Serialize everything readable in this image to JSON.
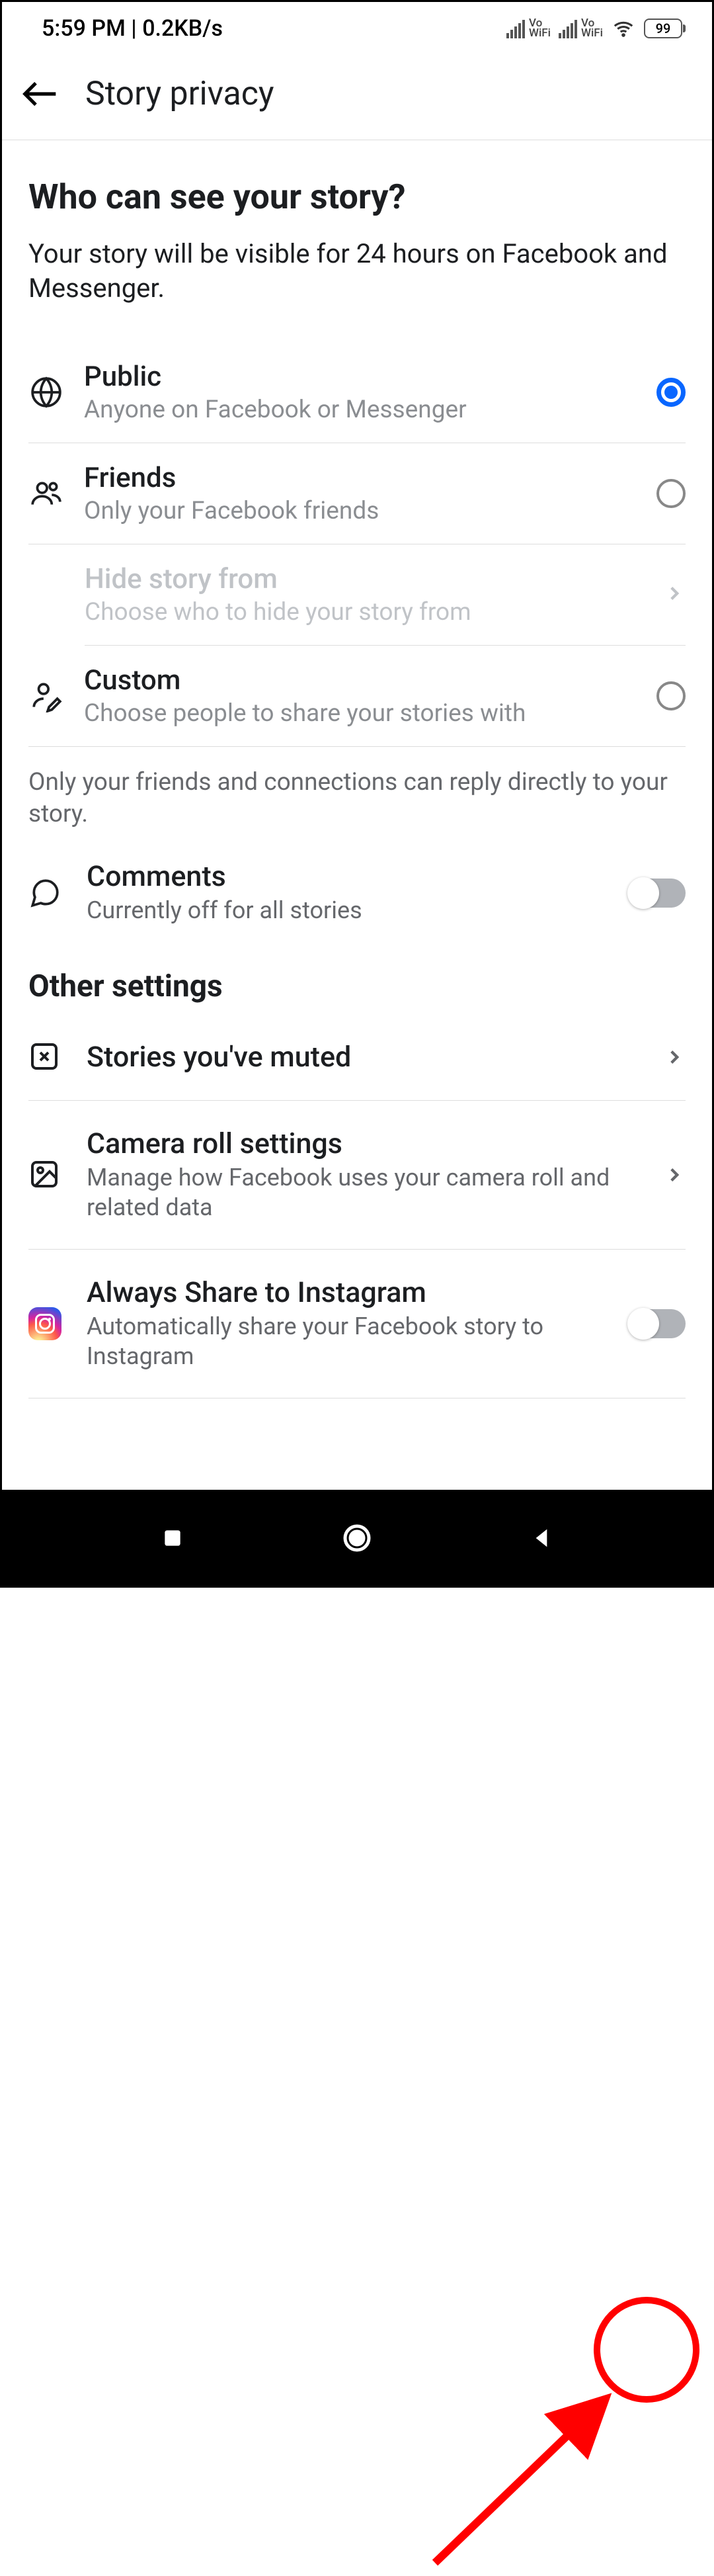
{
  "status": {
    "time": "5:59 PM",
    "data_rate": "0.2KB/s",
    "vo": "Vo",
    "wifi": "WiFi",
    "battery": "99"
  },
  "header": {
    "title": "Story privacy"
  },
  "section": {
    "title": "Who can see your story?",
    "desc": "Your story will be visible for 24 hours on Facebook and Messenger."
  },
  "options": {
    "public": {
      "title": "Public",
      "sub": "Anyone on Facebook or Messenger"
    },
    "friends": {
      "title": "Friends",
      "sub": "Only your Facebook friends"
    },
    "hide": {
      "title": "Hide story from",
      "sub": "Choose who to hide your story from"
    },
    "custom": {
      "title": "Custom",
      "sub": "Choose people to share your stories with"
    }
  },
  "reply_info": "Only your friends and connections can reply directly to your story.",
  "comments": {
    "title": "Comments",
    "sub": "Currently off for all stories"
  },
  "other": {
    "title": "Other settings",
    "muted": {
      "title": "Stories you've muted"
    },
    "camera": {
      "title": "Camera roll settings",
      "sub": "Manage how Facebook uses your camera roll and related data"
    },
    "insta": {
      "title": "Always Share to Instagram",
      "sub": "Automatically share your Facebook story to Instagram"
    }
  }
}
